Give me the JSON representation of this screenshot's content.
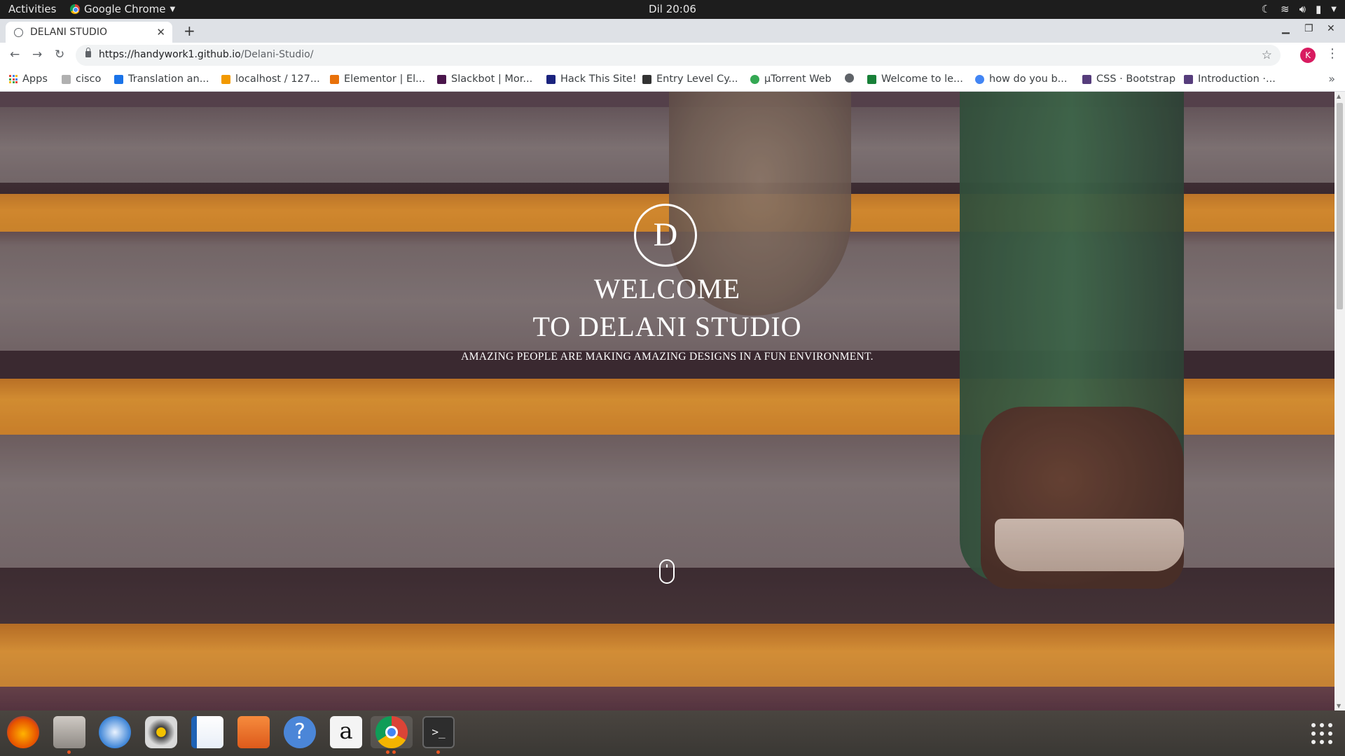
{
  "topbar": {
    "activities": "Activities",
    "app_name": "Google Chrome",
    "clock": "Dil 20:06"
  },
  "tab": {
    "title": "DELANI STUDIO"
  },
  "address": {
    "url_host": "https://handywork1.github.io",
    "url_path": "/Delani-Studio/",
    "profile_initial": "K"
  },
  "bookmarks": [
    {
      "label": "Apps",
      "color": "#4285f4"
    },
    {
      "label": "cisco",
      "color": "#5f6368"
    },
    {
      "label": "Translation an...",
      "color": "#1a73e8"
    },
    {
      "label": "localhost / 127...",
      "color": "#f29900"
    },
    {
      "label": "Elementor | El...",
      "color": "#e8710a"
    },
    {
      "label": "Slackbot | Mor...",
      "color": "#4a154b"
    },
    {
      "label": "Hack This Site!",
      "color": "#1a237e"
    },
    {
      "label": "Entry Level Cy...",
      "color": "#333333"
    },
    {
      "label": "µTorrent Web",
      "color": "#34a853"
    },
    {
      "label": "",
      "color": "#5f6368"
    },
    {
      "label": "Welcome to le...",
      "color": "#188038"
    },
    {
      "label": "how do you b...",
      "color": "#4285f4"
    },
    {
      "label": "CSS · Bootstrap",
      "color": "#563d7c"
    },
    {
      "label": "Introduction ·...",
      "color": "#563d7c"
    }
  ],
  "hero": {
    "logo_letter": "D",
    "line1": "WELCOME",
    "line2": "TO DELANI STUDIO",
    "subtitle": "AMAZING PEOPLE ARE MAKING AMAZING DESIGNS IN A FUN ENVIRONMENT."
  },
  "dock": {
    "apps": [
      "firefox-icon",
      "files-icon",
      "thunderbird-icon",
      "rhythmbox-icon",
      "writer-icon",
      "software-center-icon",
      "help-icon",
      "amazon-icon",
      "chrome-icon",
      "terminal-icon"
    ],
    "colors": {
      "accent": "#e95420"
    }
  }
}
